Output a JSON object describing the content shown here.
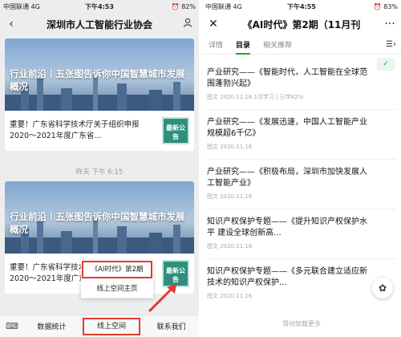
{
  "left": {
    "status": {
      "carrier": "中国联通  4G",
      "time": "下午4:53",
      "battery": "82%"
    },
    "nav": {
      "back_icon": "‹",
      "title": "深圳市人工智能行业协会",
      "profile_icon": "person-icon"
    },
    "card1": {
      "banner_text": "行业前沿丨五张图告诉你中国智慧城市发展概况",
      "sub_text": "重要！广东省科学技术厅关于组织申报 2020～2021年度广东省...",
      "badge": "最新公告"
    },
    "timestamp": "昨天 下午 6:15",
    "card2": {
      "banner_text": "行业前沿丨五张图告诉你中国智慧城市发展概况",
      "sub_text": "重要！广东省科学技术厅关于组织申报 2020～2021年度广东省...",
      "badge": "最新公告"
    },
    "popup": {
      "option1": "《AI时代》第2期",
      "option2": "线上空间主页"
    },
    "bottom": {
      "item1": "数据统计",
      "item2": "线上空间",
      "item3": "联系我们"
    }
  },
  "right": {
    "status": {
      "carrier": "中国联通  4G",
      "time": "下午4:55",
      "battery": "83%"
    },
    "nav": {
      "title": "《AI时代》第2期（11月刊",
      "more": "···"
    },
    "tabs": [
      "详情",
      "目录",
      "相关推荐"
    ],
    "wx": "✓",
    "articles": [
      {
        "title": "产业研究——《智能时代，人工智能在全球范围蓬勃兴起》",
        "meta": "图文  2020.11.16  1次学习 | 已学82%"
      },
      {
        "title": "产业研究——《发展迅速，中国人工智能产业规模超6千亿》",
        "meta": "图文  2020.11.16"
      },
      {
        "title": "产业研究——《积极布局，深圳市加快发展人工智能产业》",
        "meta": "图文  2020.11.16"
      },
      {
        "title": "知识产权保护专题——《提升知识产权保护水平 建设全球创新高...",
        "meta": "图文  2020.11.16"
      },
      {
        "title": "知识产权保护专题——《多元联合建立适应新技术的知识产权保护...",
        "meta": "图文  2020.11.16"
      }
    ],
    "load_more": "滑动加载更多"
  }
}
